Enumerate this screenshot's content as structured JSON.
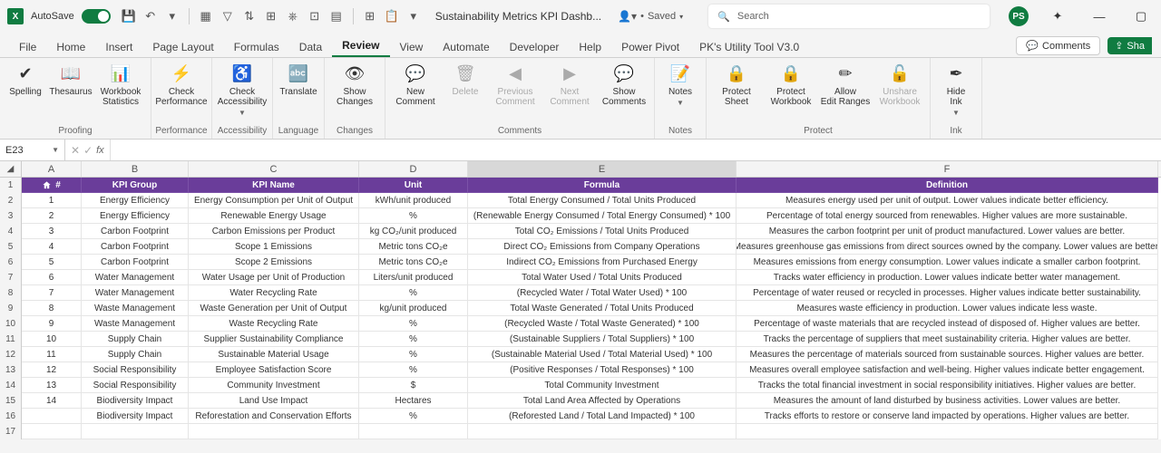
{
  "titlebar": {
    "autosave": "AutoSave",
    "doc_title": "Sustainability Metrics KPI Dashb...",
    "saved": "Saved",
    "search_placeholder": "Search",
    "avatar": "PS"
  },
  "tabs": {
    "items": [
      "File",
      "Home",
      "Insert",
      "Page Layout",
      "Formulas",
      "Data",
      "Review",
      "View",
      "Automate",
      "Developer",
      "Help",
      "Power Pivot",
      "PK's Utility Tool V3.0"
    ],
    "active": "Review",
    "comments": "Comments",
    "share": "Sha"
  },
  "ribbon": {
    "groups": [
      {
        "label": "Proofing",
        "buttons": [
          {
            "icon": "✔",
            "text": "Spelling"
          },
          {
            "icon": "📖",
            "text": "Thesaurus"
          },
          {
            "icon": "📊",
            "text": "Workbook Statistics"
          }
        ]
      },
      {
        "label": "Performance",
        "buttons": [
          {
            "icon": "⚡",
            "text": "Check Performance"
          }
        ]
      },
      {
        "label": "Accessibility",
        "buttons": [
          {
            "icon": "♿",
            "text": "Check Accessibility",
            "dropdown": true
          }
        ]
      },
      {
        "label": "Language",
        "buttons": [
          {
            "icon": "🔤",
            "text": "Translate"
          }
        ]
      },
      {
        "label": "Changes",
        "buttons": [
          {
            "icon": "👁",
            "text": "Show Changes"
          }
        ]
      },
      {
        "label": "Comments",
        "buttons": [
          {
            "icon": "💬",
            "text": "New Comment"
          },
          {
            "icon": "🗑",
            "text": "Delete",
            "disabled": true
          },
          {
            "icon": "◀",
            "text": "Previous Comment",
            "disabled": true
          },
          {
            "icon": "▶",
            "text": "Next Comment",
            "disabled": true
          },
          {
            "icon": "💬",
            "text": "Show Comments"
          }
        ]
      },
      {
        "label": "Notes",
        "buttons": [
          {
            "icon": "📝",
            "text": "Notes",
            "dropdown": true
          }
        ]
      },
      {
        "label": "Protect",
        "buttons": [
          {
            "icon": "🔒",
            "text": "Protect Sheet"
          },
          {
            "icon": "🔒",
            "text": "Protect Workbook"
          },
          {
            "icon": "✏",
            "text": "Allow Edit Ranges"
          },
          {
            "icon": "🔓",
            "text": "Unshare Workbook",
            "disabled": true
          }
        ]
      },
      {
        "label": "Ink",
        "buttons": [
          {
            "icon": "✒",
            "text": "Hide Ink",
            "dropdown": true
          }
        ]
      }
    ]
  },
  "namebox": "E23",
  "columns": [
    "A",
    "B",
    "C",
    "D",
    "E",
    "F"
  ],
  "header_row": [
    "#",
    "KPI Group",
    "KPI Name",
    "Unit",
    "Formula",
    "Definition"
  ],
  "data_rows": [
    [
      "1",
      "Energy Efficiency",
      "Energy Consumption per Unit of Output",
      "kWh/unit produced",
      "Total Energy Consumed / Total Units Produced",
      "Measures energy used per unit of output. Lower values indicate better efficiency."
    ],
    [
      "2",
      "Energy Efficiency",
      "Renewable Energy Usage",
      "%",
      "(Renewable Energy Consumed / Total Energy Consumed) * 100",
      "Percentage of total energy sourced from renewables. Higher values are more sustainable."
    ],
    [
      "3",
      "Carbon Footprint",
      "Carbon Emissions per Product",
      "kg CO₂/unit produced",
      "Total CO₂ Emissions / Total Units Produced",
      "Measures the carbon footprint per unit of product manufactured. Lower values are better."
    ],
    [
      "4",
      "Carbon Footprint",
      "Scope 1 Emissions",
      "Metric tons CO₂e",
      "Direct CO₂ Emissions from Company Operations",
      "Measures greenhouse gas emissions from direct sources owned by the company. Lower values are better."
    ],
    [
      "5",
      "Carbon Footprint",
      "Scope 2 Emissions",
      "Metric tons CO₂e",
      "Indirect CO₂ Emissions from Purchased Energy",
      "Measures emissions from energy consumption. Lower values indicate a smaller carbon footprint."
    ],
    [
      "6",
      "Water Management",
      "Water Usage per Unit of Production",
      "Liters/unit produced",
      "Total Water Used / Total Units Produced",
      "Tracks water efficiency in production. Lower values indicate better water management."
    ],
    [
      "7",
      "Water Management",
      "Water Recycling Rate",
      "%",
      "(Recycled Water / Total Water Used) * 100",
      "Percentage of water reused or recycled in processes. Higher values indicate better sustainability."
    ],
    [
      "8",
      "Waste Management",
      "Waste Generation per Unit of Output",
      "kg/unit produced",
      "Total Waste Generated / Total Units Produced",
      "Measures waste efficiency in production. Lower values indicate less waste."
    ],
    [
      "9",
      "Waste Management",
      "Waste Recycling Rate",
      "%",
      "(Recycled Waste / Total Waste Generated) * 100",
      "Percentage of waste materials that are recycled instead of disposed of. Higher values are better."
    ],
    [
      "10",
      "Supply Chain",
      "Supplier Sustainability Compliance",
      "%",
      "(Sustainable Suppliers / Total Suppliers) * 100",
      "Tracks the percentage of suppliers that meet sustainability criteria. Higher values are better."
    ],
    [
      "11",
      "Supply Chain",
      "Sustainable Material Usage",
      "%",
      "(Sustainable Material Used / Total Material Used) * 100",
      "Measures the percentage of materials sourced from sustainable sources. Higher values are better."
    ],
    [
      "12",
      "Social Responsibility",
      "Employee Satisfaction Score",
      "%",
      "(Positive Responses / Total Responses) * 100",
      "Measures overall employee satisfaction and well-being. Higher values indicate better engagement."
    ],
    [
      "13",
      "Social Responsibility",
      "Community Investment",
      "$",
      "Total Community Investment",
      "Tracks the total financial investment in social responsibility initiatives. Higher values are better."
    ],
    [
      "14",
      "Biodiversity Impact",
      "Land Use Impact",
      "Hectares",
      "Total Land Area Affected by Operations",
      "Measures the amount of land disturbed by business activities. Lower values are better."
    ],
    [
      "",
      "Biodiversity Impact",
      "Reforestation and Conservation Efforts",
      "%",
      "(Reforested Land / Total Land Impacted) * 100",
      "Tracks efforts to restore or conserve land impacted by operations. Higher values are better."
    ]
  ],
  "blank_rows": [
    17
  ]
}
